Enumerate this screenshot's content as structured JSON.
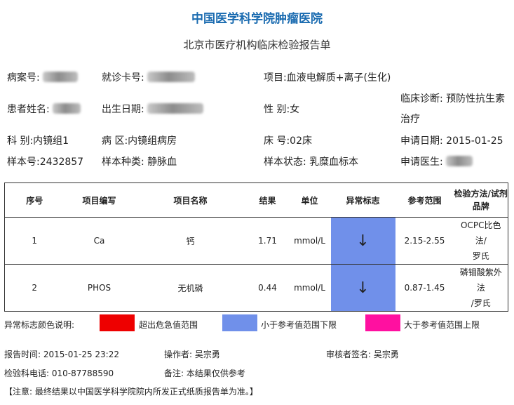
{
  "header": {
    "hospital": "中国医学科学院肿瘤医院",
    "report_title": "北京市医疗机构临床检验报告单"
  },
  "patient": {
    "record_no_label": "病案号:",
    "visit_card_label": "就诊卡号:",
    "item": "项目:血液电解质+离子(生化)",
    "name_label": "患者姓名:",
    "birth_label": "出生日期:",
    "sex": "性 别:女",
    "diagnosis_line1": "临床诊断: 预防性抗生素",
    "diagnosis_line2": "治疗",
    "department": "科 别:内镜组1",
    "ward": "病 区:内镜组病房",
    "bed": "床 号:02床",
    "apply_date": "申请日期: 2015-01-25",
    "sample_no": "样本号:2432857",
    "sample_type": "样本种类: 静脉血",
    "sample_status": "样本状态: 乳糜血标本",
    "apply_doctor_label": "申请医生:"
  },
  "table": {
    "headers": [
      "序号",
      "项目编写",
      "项目名称",
      "结果",
      "单位",
      "异常标志",
      "参考范围",
      "检验方法/试剂品牌"
    ],
    "rows": [
      {
        "no": "1",
        "code": "Ca",
        "name": "钙",
        "result": "1.71",
        "unit": "mmol/L",
        "flag": "↓",
        "range": "2.15-2.55",
        "method_line1": "OCPC比色法/",
        "method_line2": "罗氏"
      },
      {
        "no": "2",
        "code": "PHOS",
        "name": "无机磷",
        "result": "0.44",
        "unit": "mmol/L",
        "flag": "↓",
        "range": "0.87-1.45",
        "method_line1": "磷钼酸紫外法",
        "method_line2": "/罗氏"
      }
    ]
  },
  "legend": {
    "title": "异常标志颜色说明:",
    "critical": "超出危急值范围",
    "below": "小于参考值范围下限",
    "above": "大于参考值范围上限",
    "colors": {
      "critical": "#ee0000",
      "below": "#7090ea",
      "above": "#ff10a0"
    }
  },
  "footer": {
    "report_time": "报告时间: 2015-01-25 23:22",
    "operator": "操作者: 吴宗勇",
    "reviewer": "审核者签名: 吴宗勇",
    "phone": "检验科电话: 010-87788590",
    "remark": "备注: 本结果仅供参考",
    "notice": "【注意: 最终结果以中国医学科学院院内所发正式纸质报告单为准。】"
  }
}
